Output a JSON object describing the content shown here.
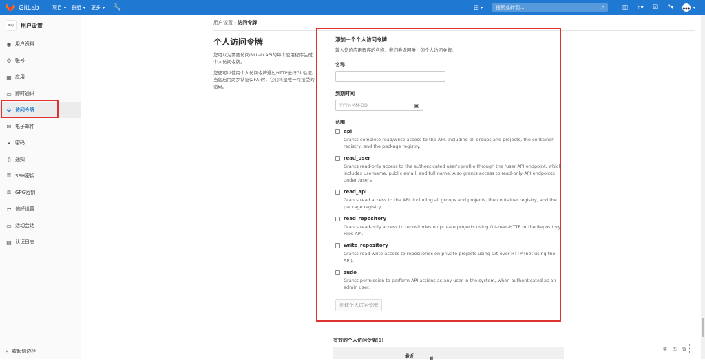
{
  "header": {
    "brand": "GitLab",
    "nav": [
      {
        "label": "项目"
      },
      {
        "label": "群组"
      },
      {
        "label": "更多"
      }
    ],
    "search_placeholder": "搜索或转到..."
  },
  "sidebar": {
    "title": "用户设置",
    "items": [
      {
        "label": "用户资料",
        "icon": "profile-icon"
      },
      {
        "label": "帐号",
        "icon": "account-icon"
      },
      {
        "label": "应用",
        "icon": "applications-icon"
      },
      {
        "label": "即时通讯",
        "icon": "chat-icon"
      },
      {
        "label": "访问令牌",
        "icon": "token-icon",
        "active": true
      },
      {
        "label": "电子邮件",
        "icon": "email-icon"
      },
      {
        "label": "密码",
        "icon": "lock-icon"
      },
      {
        "label": "通知",
        "icon": "bell-icon"
      },
      {
        "label": "SSH密钥",
        "icon": "key-icon"
      },
      {
        "label": "GPG密钥",
        "icon": "key-icon"
      },
      {
        "label": "偏好设置",
        "icon": "preferences-icon"
      },
      {
        "label": "活动会话",
        "icon": "sessions-icon"
      },
      {
        "label": "认证日志",
        "icon": "log-icon"
      }
    ],
    "collapse": "收起侧边栏"
  },
  "breadcrumb": {
    "parent": "用户设置",
    "current": "访问令牌"
  },
  "page": {
    "title": "个人访问令牌",
    "desc1": "您可以为需要访问GitLab API的每个应用程序生成个人访问令牌。",
    "desc2": "您还可以使用个人访问令牌通过HTTP进行Git验证。 当您启用两步认证(2FA)时，它们将是唯一可接受的密码。"
  },
  "form": {
    "title": "添加一个个人访问令牌",
    "subtitle": "输入您的应用程序的名称，我们会返回唯一的个人访问令牌。",
    "name_label": "名称",
    "expiry_label": "到期时间",
    "expiry_placeholder": "YYYY-MM-DD",
    "scopes_label": "范围",
    "scopes": [
      {
        "name": "api",
        "desc": "Grants complete read/write access to the API, including all groups and projects, the container registry, and the package registry."
      },
      {
        "name": "read_user",
        "desc": "Grants read-only access to the authenticated user's profile through the /user API endpoint, which includes username, public email, and full name. Also grants access to read-only API endpoints under /users."
      },
      {
        "name": "read_api",
        "desc": "Grants read access to the API, including all groups and projects, the container registry, and the package registry."
      },
      {
        "name": "read_repository",
        "desc": "Grants read-only access to repositories on private projects using Git-over-HTTP or the Repository Files API."
      },
      {
        "name": "write_repository",
        "desc": "Grants read-write access to repositories on private projects using Git-over-HTTP (not using the API)."
      },
      {
        "name": "sudo",
        "desc": "Grants permission to perform API actions as any user in the system, when authenticated as an admin user."
      }
    ],
    "create_button": "创建个人访问令牌"
  },
  "active_tokens": {
    "title": "有效的个人访问令牌",
    "count": "(1)",
    "col1": "最近",
    "col2": "到"
  },
  "watermark": [
    "笑",
    "杰",
    "饭"
  ]
}
